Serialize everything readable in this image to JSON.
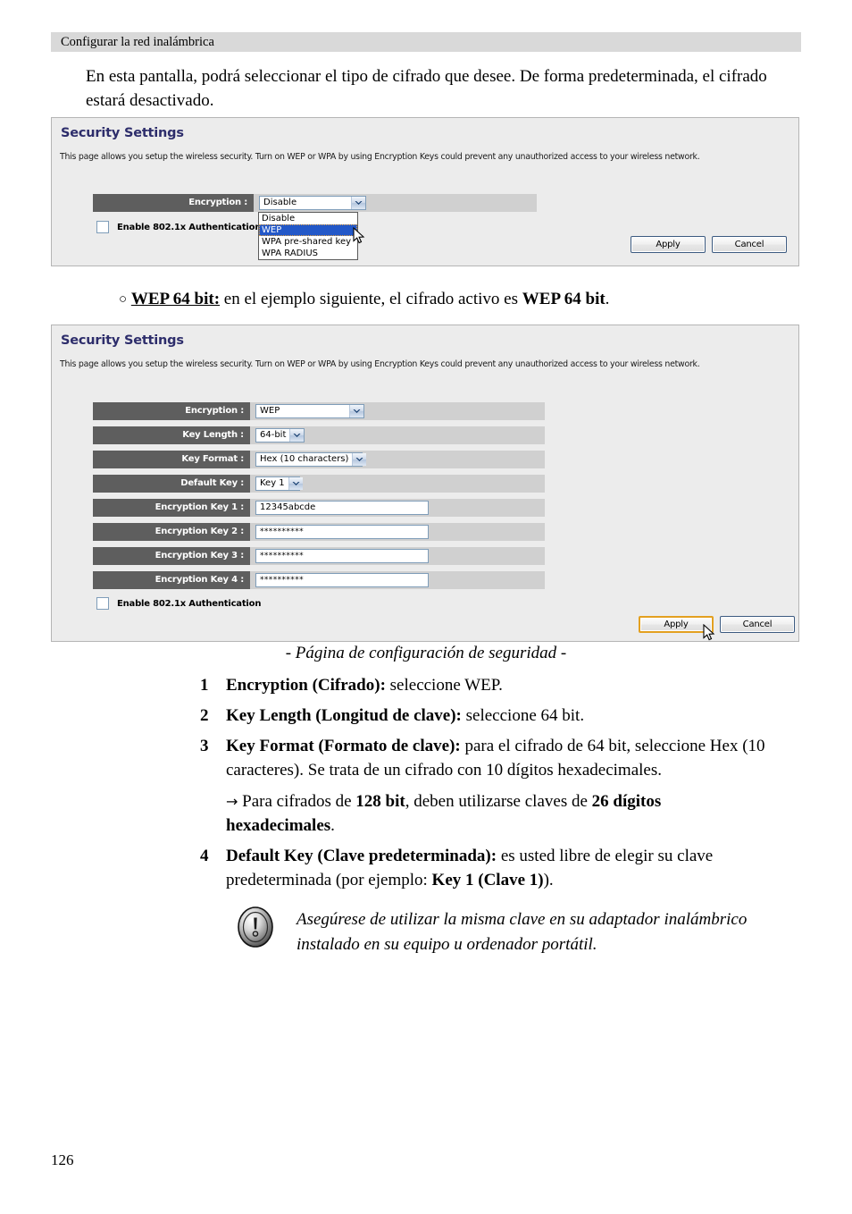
{
  "running_head": "Configurar la red inalámbrica",
  "intro_paragraph": "En esta pantalla, podrá seleccionar el tipo de cifrado que desee. De forma predeterminada, el cifrado estará desactivado.",
  "panel1": {
    "title": "Security Settings",
    "description": "This page allows you setup the wireless security. Turn on WEP or WPA by using Encryption Keys could prevent any unauthorized access to your wireless network.",
    "encryption_label": "Encryption :",
    "encryption_value": "Disable",
    "dropdown_options": [
      "Disable",
      "WEP",
      "WPA pre-shared key",
      "WPA RADIUS"
    ],
    "dropdown_selected": "WEP",
    "checkbox_label": "Enable 802.1x Authentication",
    "checkbox_checked": false,
    "apply_label": "Apply",
    "cancel_label": "Cancel"
  },
  "between_paragraph": {
    "bullet": "○",
    "lead": "WEP 64 bit:",
    "middle": " en el ejemplo siguiente, el cifrado activo es ",
    "bold_tail": "WEP 64 bit",
    "period": "."
  },
  "panel2": {
    "title": "Security Settings",
    "description": "This page allows you setup the wireless security. Turn on WEP or WPA by using Encryption Keys could prevent any unauthorized access to your wireless network.",
    "rows": [
      {
        "label": "Encryption :",
        "type": "select",
        "value": "WEP"
      },
      {
        "label": "Key Length :",
        "type": "select",
        "value": "64-bit"
      },
      {
        "label": "Key Format :",
        "type": "select",
        "value": "Hex (10 characters)"
      },
      {
        "label": "Default Key :",
        "type": "select",
        "value": "Key 1"
      },
      {
        "label": "Encryption Key 1 :",
        "type": "text",
        "value": "12345abcde"
      },
      {
        "label": "Encryption Key 2 :",
        "type": "text",
        "value": "**********"
      },
      {
        "label": "Encryption Key 3 :",
        "type": "text",
        "value": "**********"
      },
      {
        "label": "Encryption Key 4 :",
        "type": "text",
        "value": "**********"
      }
    ],
    "checkbox_label": "Enable 802.1x Authentication",
    "checkbox_checked": false,
    "apply_label": "Apply",
    "cancel_label": "Cancel",
    "apply_state": "hover"
  },
  "caption": "- Página de configuración de seguridad -",
  "steps": [
    {
      "number": "1",
      "bold": "Encryption (Cifrado):",
      "rest": " seleccione WEP."
    },
    {
      "number": "2",
      "bold": "Key Length (Longitud de clave):",
      "rest": " seleccione 64 bit."
    },
    {
      "number": "3",
      "bold": "Key Format (Formato de clave):",
      "rest": " para el cifrado de 64 bit, seleccione Hex (10 caracteres). Se trata de un cifrado con 10 dígitos hexadecimales."
    },
    {
      "number": "4",
      "bold": "Default Key (Clave predeterminada):",
      "rest": " es usted libre de elegir su clave predeterminada (por ejemplo: ",
      "rest_bold": "Key 1 (Clave 1)",
      "rest_tail": ")."
    }
  ],
  "sub_note": {
    "arrow": "→",
    "part1": " Para cifrados de ",
    "bold1": "128 bit",
    "part2": ", deben utilizarse claves de ",
    "bold2": "26 dígitos hexadecimales",
    "part3": "."
  },
  "note": {
    "line1": "Asegúrese de utilizar la misma clave en su adaptador inalámbrico",
    "line2": "instalado en su equipo u ordenador portátil."
  },
  "page_number": "126",
  "colors": {
    "panel_bg": "#ececec",
    "label_bg": "#5e5e5e",
    "row_bg": "#d0d0d0",
    "title": "#2d2d6b",
    "highlight": "#2358c8",
    "hover_border": "#e3a020",
    "running_head_bg": "#d9d9d9"
  }
}
